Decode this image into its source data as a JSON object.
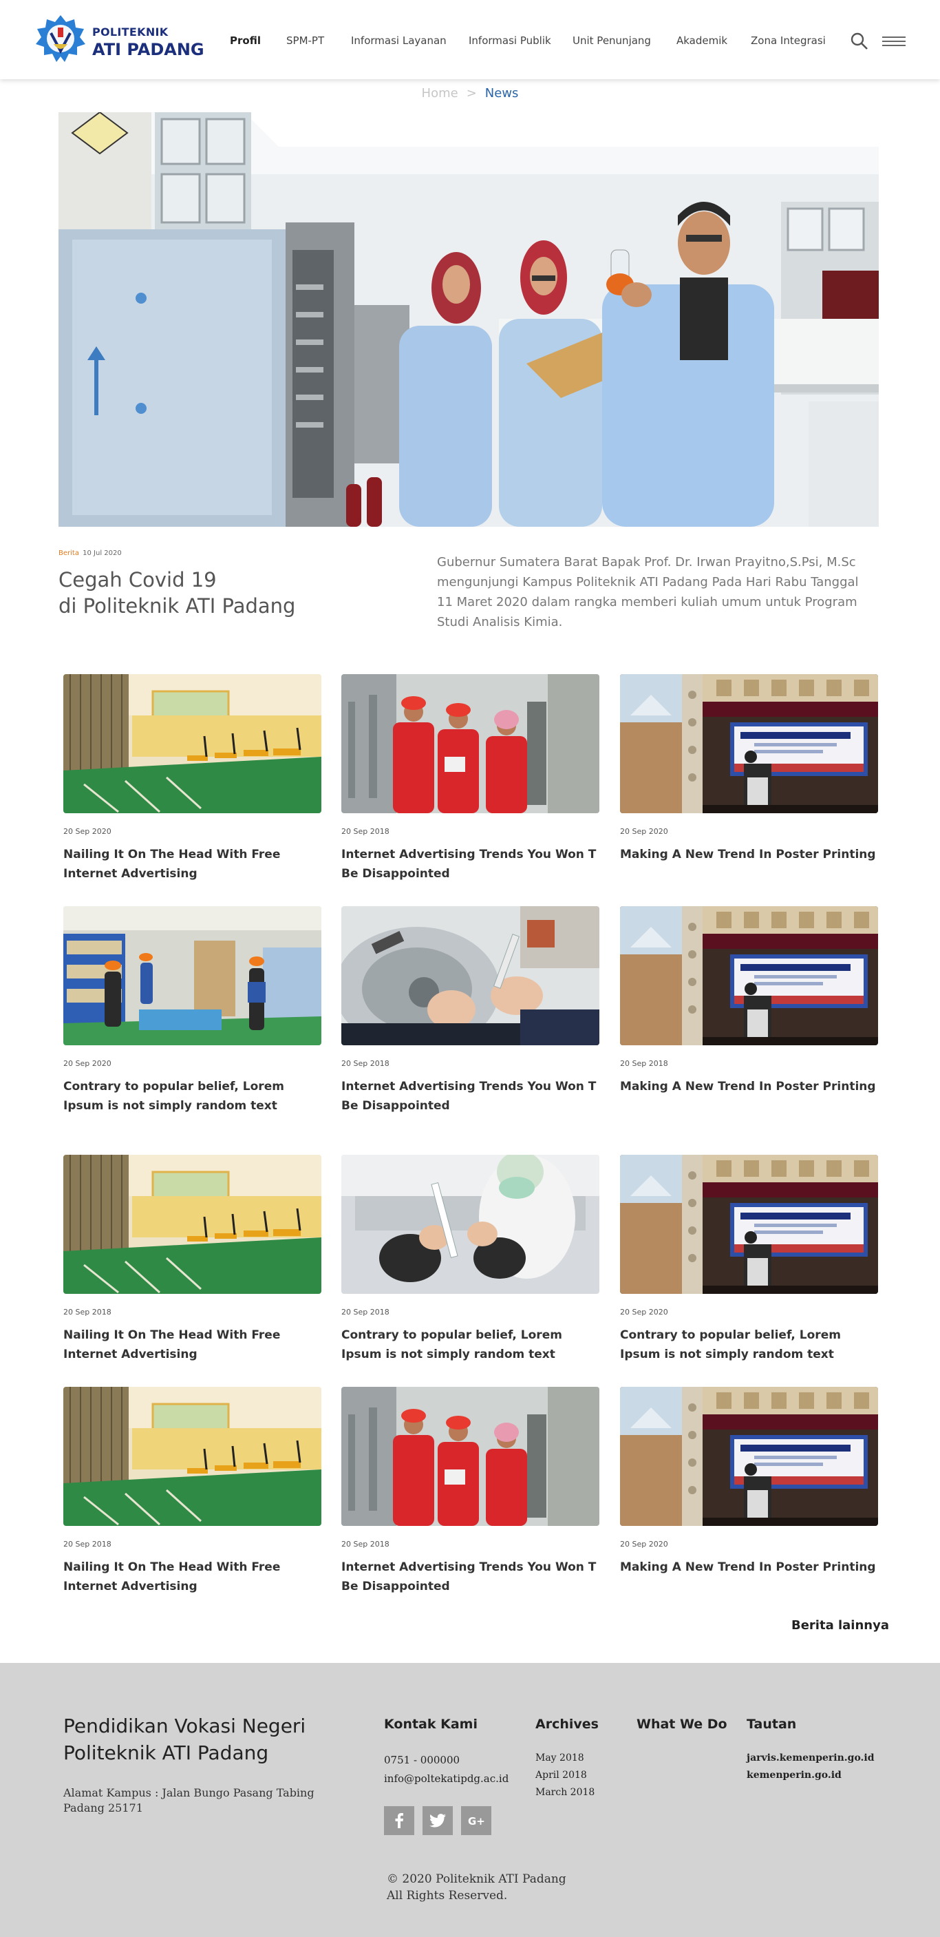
{
  "header": {
    "brand_top": "POLITEKNIK",
    "brand_bottom": "ATI PADANG",
    "nav": [
      "Profil",
      "SPM-PT",
      "Informasi Layanan",
      "Informasi Publik",
      "Unit Penunjang",
      "Akademik",
      "Zona Integrasi"
    ],
    "icons": [
      "search-icon",
      "hamburger-menu-icon"
    ]
  },
  "breadcrumb": {
    "home": "Home",
    "separator": ">",
    "current": "News"
  },
  "featured": {
    "category": "Berita",
    "date": "10 Jul 2020",
    "title_line1": "Cegah Covid 19",
    "title_line2": "di Politeknik ATI Padang",
    "description": "Gubernur Sumatera Barat Bapak Prof. Dr. Irwan Prayitno,S.Psi, M.Sc mengunjungi Kampus Politeknik ATI Padang Pada Hari Rabu Tanggal 11 Maret 2020 dalam rangka memberi kuliah umum untuk Program Studi Analisis Kimia."
  },
  "cards": [
    {
      "date": "20 Sep 2020",
      "title": "Nailing It On The Head With Free Internet Advertising",
      "image": "warehouse-photo"
    },
    {
      "date": "20 Sep 2018",
      "title": "Internet Advertising Trends You Won T Be Disappointed",
      "image": "workers-red-photo"
    },
    {
      "date": "20 Sep 2020",
      "title": "Making A New Trend In Poster Printing",
      "image": "seminar-photo"
    },
    {
      "date": "20 Sep 2020",
      "title": "Contrary to popular belief, Lorem Ipsum is not simply random text",
      "image": "warehouse-workers-photo"
    },
    {
      "date": "20 Sep 2018",
      "title": "Internet Advertising Trends You Won T Be Disappointed",
      "image": "lab-hands-photo"
    },
    {
      "date": "20 Sep 2018",
      "title": "Making A New Trend In Poster Printing",
      "image": "seminar-photo"
    },
    {
      "date": "20 Sep 2018",
      "title": "Nailing It On The Head With Free Internet Advertising",
      "image": "warehouse-photo"
    },
    {
      "date": "20 Sep 2018",
      "title": "Contrary to popular belief, Lorem Ipsum is not simply random text",
      "image": "lab-mask-photo"
    },
    {
      "date": "20 Sep 2020",
      "title": "Contrary to popular belief, Lorem Ipsum is not simply random text",
      "image": "seminar-photo"
    },
    {
      "date": "20 Sep 2018",
      "title": "Nailing It On The Head With Free Internet Advertising",
      "image": "warehouse-photo"
    },
    {
      "date": "20 Sep 2018",
      "title": "Internet Advertising Trends You Won T Be Disappointed",
      "image": "workers-red-photo"
    },
    {
      "date": "20 Sep 2020",
      "title": "Making A New Trend In Poster Printing",
      "image": "seminar-photo"
    }
  ],
  "more_link": "Berita lainnya",
  "footer": {
    "title_line1": "Pendidikan Vokasi Negeri",
    "title_line2": "Politeknik ATI Padang",
    "address_line1": "Alamat Kampus : Jalan Bungo Pasang Tabing",
    "address_line2": "Padang 25171",
    "contact": {
      "heading": "Kontak Kami",
      "phone": "0751 - 000000",
      "email": "info@poltekatipdg.ac.id"
    },
    "archives": {
      "heading": "Archives",
      "items": [
        "May 2018",
        "April 2018",
        "March 2018"
      ]
    },
    "what_we_do": {
      "heading": "What We Do"
    },
    "links": {
      "heading": "Tautan",
      "items": [
        "jarvis.kemenperin.go.id",
        "kemenperin.go.id"
      ]
    },
    "social": [
      "facebook-icon",
      "twitter-icon",
      "google-plus-icon"
    ],
    "copyright_line1": "© 2020 Politeknik ATI Padang",
    "copyright_line2": "All Rights Reserved."
  },
  "colors": {
    "brand": "#1c2f7c",
    "link": "#2a64a8",
    "category": "#e07a1f",
    "footer_bg": "#d3d3d3"
  }
}
